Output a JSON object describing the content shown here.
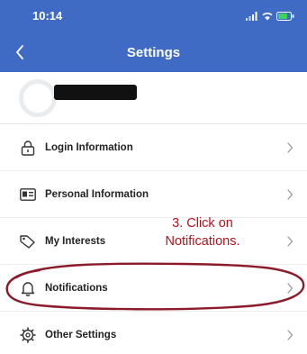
{
  "status_bar": {
    "time": "10:14"
  },
  "nav": {
    "title": "Settings"
  },
  "profile": {},
  "menu": [
    {
      "label": "Login Information",
      "icon": "lock-icon"
    },
    {
      "label": "Personal Information",
      "icon": "id-card-icon"
    },
    {
      "label": "My Interests",
      "icon": "tag-icon"
    },
    {
      "label": "Notifications",
      "icon": "bell-icon"
    },
    {
      "label": "Other Settings",
      "icon": "gear-icon"
    }
  ],
  "annotation": {
    "line1": "3.  Click on",
    "line2": "Notifications.",
    "color": "#b3121b"
  },
  "colors": {
    "header": "#3f6bc4",
    "annotation": "#b3121b"
  }
}
